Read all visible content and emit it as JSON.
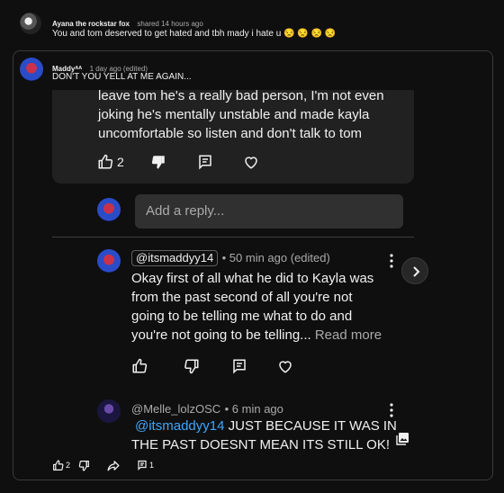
{
  "top_comment": {
    "author": "Ayana the rockstar fox",
    "meta": "shared 14 hours ago",
    "text": "You and tom deserved to get hated and tbh mady i hate u 😒 😒 😒 😒"
  },
  "shared_card": {
    "author": "Maddyᴬᴬ",
    "meta": "1 day ago (edited)",
    "text": "DON'T YOU YELL AT ME AGAIN...",
    "footer": {
      "like_count": "2",
      "reply_count": "1"
    }
  },
  "embedded_comment": {
    "lines": [
      "leave tom he's a really bad person, I'm not even",
      "joking he's mentally unstable and made kayla",
      "uncomfortable so listen and don't talk to tom"
    ],
    "like_count": "2"
  },
  "reply_box": {
    "placeholder": "Add a reply..."
  },
  "reply_1": {
    "handle": "@itsmaddyy14",
    "meta": "• 50 min ago (edited)",
    "lines": [
      "Okay first of all what he did to Kayla was",
      "from the past second of all you're not",
      "going to be telling me what to do and",
      "you're not going to be telling..."
    ],
    "read_more": "Read more"
  },
  "reply_2": {
    "handle": "@Melle_lolzOSC",
    "meta": "• 6 min ago",
    "mention": "@itsmaddyy14",
    "line1": "JUST BECAUSE IT WAS IN",
    "line2": "THE PAST DOESNT MEAN ITS STILL OK!"
  },
  "colors": {
    "background": "#0f0f0f",
    "panel": "#212121",
    "mention": "#3ea6ff",
    "meta": "#aaaaaa"
  },
  "icons": [
    "thumbs-up-icon",
    "thumbs-down-icon",
    "reply-icon",
    "heart-icon",
    "more-vert-icon",
    "chevron-right-icon",
    "share-icon",
    "image-icon"
  ]
}
